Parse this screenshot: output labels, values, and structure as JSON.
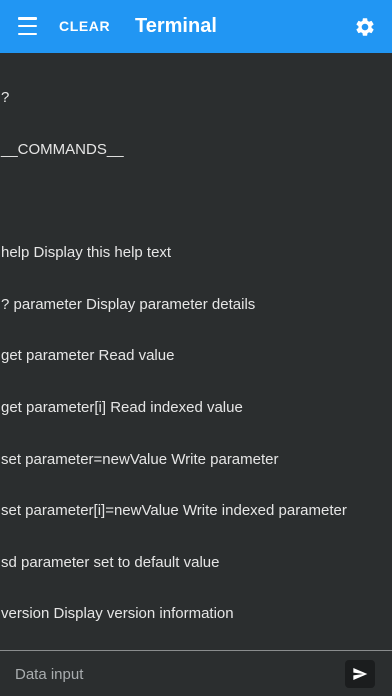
{
  "toolbar": {
    "menu_icon": "hamburger-menu-icon",
    "clear_label": "CLEAR",
    "title": "Terminal",
    "settings_icon": "gear-icon",
    "background_color": "#2196f3"
  },
  "terminal": {
    "lines": [
      "?",
      "__COMMANDS__",
      "",
      "help Display this help text",
      "? parameter Display parameter details",
      "get parameter Read value",
      "get parameter[i] Read indexed value",
      "set parameter=newValue Write parameter",
      "set parameter[i]=newValue Write indexed parameter",
      "sd parameter set to default value",
      "version Display version information",
      ">"
    ],
    "background_color": "#2b2e2f",
    "text_color": "#e6e6e6"
  },
  "input_bar": {
    "placeholder": "Data input",
    "value": "",
    "send_icon": "send-icon"
  }
}
